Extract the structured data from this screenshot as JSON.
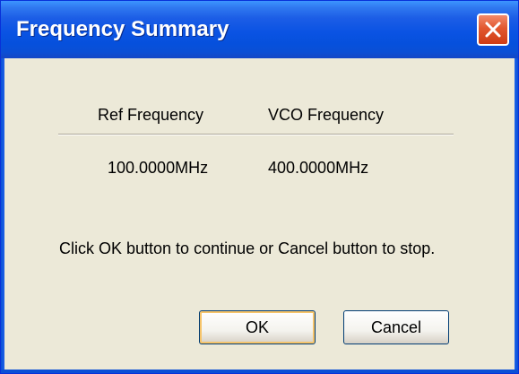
{
  "window": {
    "title": "Frequency Summary"
  },
  "summary": {
    "headers": [
      "Ref Frequency",
      "VCO Frequency"
    ],
    "values": [
      "100.0000MHz",
      "400.0000MHz"
    ]
  },
  "message": "Click OK button to continue or Cancel button to stop.",
  "buttons": {
    "ok_label": "OK",
    "cancel_label": "Cancel"
  },
  "icons": {
    "close": "close-icon"
  },
  "colors": {
    "titlebar": "#0a53e3",
    "close_button": "#e2572f",
    "dialog_background": "#ece9d8",
    "default_button_focus": "#f6c46a"
  }
}
